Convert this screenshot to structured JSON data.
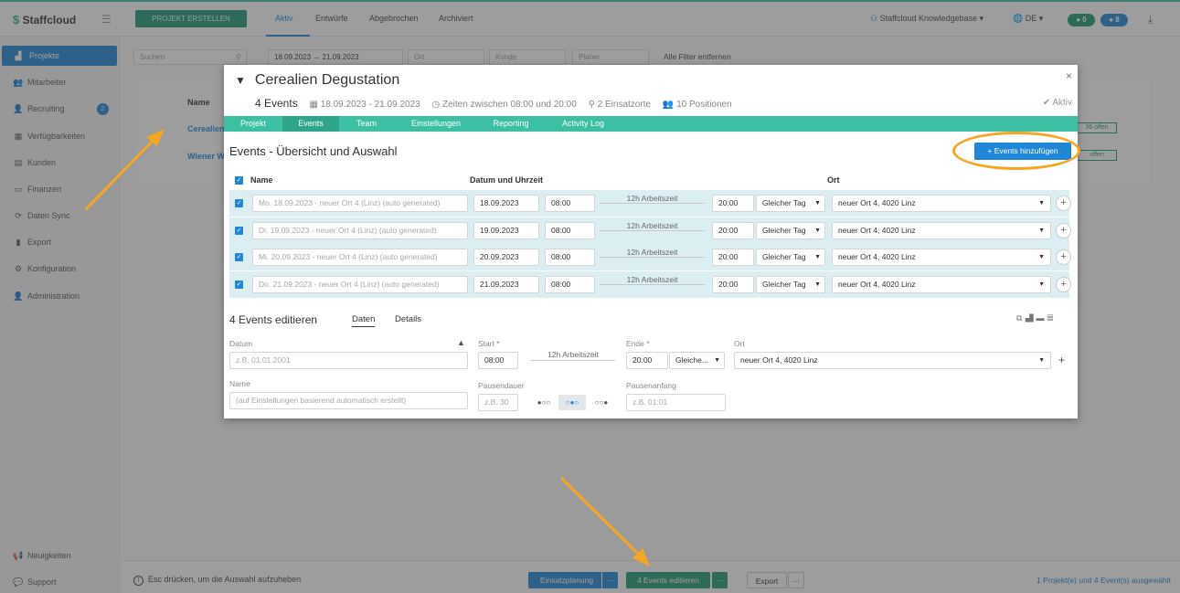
{
  "app": {
    "name": "Staffcloud"
  },
  "topbar": {
    "create_label": "PROJEKT ERSTELLEN",
    "tabs": [
      "Aktiv",
      "Entwürfe",
      "Abgebrochen",
      "Archiviert"
    ],
    "account": "Staffcloud Knowledgebase",
    "lang": "DE",
    "badge_green": "0",
    "badge_blue": "8"
  },
  "sidebar": {
    "items": [
      {
        "label": "Projekte",
        "icon": "sitemap-icon"
      },
      {
        "label": "Mitarbeiter",
        "icon": "users-icon"
      },
      {
        "label": "Recruiting",
        "icon": "user-plus-icon",
        "badge": "2"
      },
      {
        "label": "Verfügbarkeiten",
        "icon": "calendar-icon"
      },
      {
        "label": "Kunden",
        "icon": "building-icon"
      },
      {
        "label": "Finanzen",
        "icon": "money-icon"
      },
      {
        "label": "Daten Sync",
        "icon": "sync-icon"
      },
      {
        "label": "Export",
        "icon": "file-icon"
      },
      {
        "label": "Konfiguration",
        "icon": "gear-icon"
      },
      {
        "label": "Administration",
        "icon": "admin-icon"
      }
    ],
    "bottom": [
      {
        "label": "Neuigkeiten",
        "icon": "megaphone-icon"
      },
      {
        "label": "Support",
        "icon": "chat-icon"
      }
    ]
  },
  "filters": {
    "search_placeholder": "Suchen",
    "date_from": "18.09.2023",
    "date_to": "21.09.2023",
    "ort": "Ort",
    "kunde": "Kunde",
    "planer": "Planer",
    "clear": "Alle Filter entfernen"
  },
  "list": {
    "name_header": "Name",
    "rows": [
      "Cerealien",
      "Wiener W"
    ],
    "open_badge": "36 offen",
    "open_badge2": "offen"
  },
  "modal": {
    "title": "Cerealien Degustation",
    "events_count": "4 Events",
    "date_range": "18.09.2023 - 21.09.2023",
    "times": "Zeiten zwischen 08:00 und 20:00",
    "locations": "2 Einsatzorte",
    "positions": "10 Positionen",
    "status": "Aktiv",
    "tabs": [
      "Projekt",
      "Events",
      "Team",
      "Einstellungen",
      "Reporting",
      "Activity Log"
    ],
    "section_title": "Events - Übersicht und Auswahl",
    "add_button": "Events hinzufügen",
    "headers": {
      "name": "Name",
      "datetime": "Datum und Uhrzeit",
      "ort": "Ort"
    },
    "events": [
      {
        "name": "Mo. 18.09.2023 - neuer Ort 4 (Linz) (auto generated)",
        "date": "18.09.2023",
        "start": "08:00",
        "duration": "12h Arbeitszeit",
        "end": "20:00",
        "day": "Gleicher Tag",
        "ort": "neuer Ort 4, 4020 Linz"
      },
      {
        "name": "Di. 19.09.2023 - neuer Ort 4 (Linz) (auto generated)",
        "date": "19.09.2023",
        "start": "08:00",
        "duration": "12h Arbeitszeit",
        "end": "20:00",
        "day": "Gleicher Tag",
        "ort": "neuer Ort 4, 4020 Linz"
      },
      {
        "name": "Mi. 20.09.2023 - neuer Ort 4 (Linz) (auto generated)",
        "date": "20.09.2023",
        "start": "08:00",
        "duration": "12h Arbeitszeit",
        "end": "20:00",
        "day": "Gleicher Tag",
        "ort": "neuer Ort 4, 4020 Linz"
      },
      {
        "name": "Do. 21.09.2023 - neuer Ort 4 (Linz) (auto generated)",
        "date": "21.09.2023",
        "start": "08:00",
        "duration": "12h Arbeitszeit",
        "end": "20:00",
        "day": "Gleicher Tag",
        "ort": "neuer Ort 4, 4020 Linz"
      }
    ],
    "edit": {
      "title": "4 Events editieren",
      "tab_daten": "Daten",
      "tab_details": "Details",
      "datum_label": "Datum",
      "datum_placeholder": "z.B. 01.01.2001",
      "start_label": "Start *",
      "start_value": "08:00",
      "duration": "12h Arbeitszeit",
      "ende_label": "Ende *",
      "ende_value": "20:00",
      "day_value": "Gleiche...",
      "ort_label": "Ort",
      "ort_value": "neuer Ort 4, 4020 Linz",
      "name_label": "Name",
      "name_placeholder": "(auf Einstellungen basierend automatisch erstellt)",
      "pause_label": "Pausendauer",
      "pause_placeholder": "z.B. 30",
      "pausestart_label": "Pausenanfang",
      "pausestart_placeholder": "z.B. 01:01"
    }
  },
  "bottombar": {
    "hint": "Esc drücken, um die Auswahl aufzuheben",
    "einsatz": "Einsatzplanung",
    "edit": "4 Events editieren",
    "export": "Export",
    "selection": "1 Projekt(e) und 4 Event(s) ausgewählt",
    "more": "···"
  },
  "colors": {
    "accent": "#1f86d8",
    "teal": "#3dbfa3",
    "green": "#1e9b74",
    "highlight": "#f5a623"
  }
}
